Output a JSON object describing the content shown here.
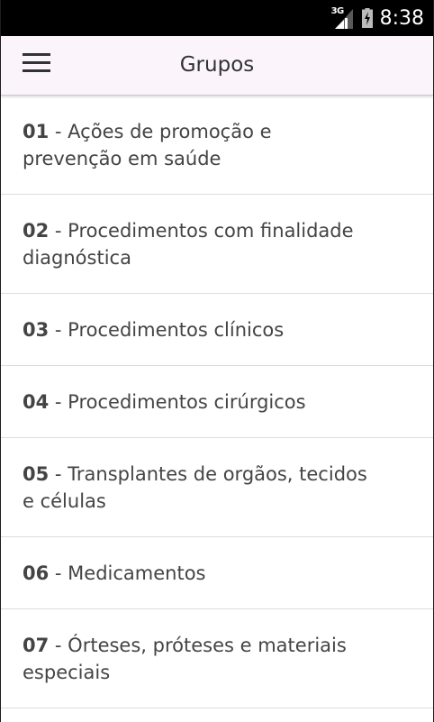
{
  "status_bar": {
    "network": "3G",
    "time": "8:38"
  },
  "app_bar": {
    "title": "Grupos",
    "menu_icon": "hamburger-menu-icon"
  },
  "groups": [
    {
      "code": "01",
      "separator": " - ",
      "name": "Ações de promoção e prevenção em saúde"
    },
    {
      "code": "02",
      "separator": " - ",
      "name": "Procedimentos com finalidade diagnóstica"
    },
    {
      "code": "03",
      "separator": " - ",
      "name": "Procedimentos clínicos"
    },
    {
      "code": "04",
      "separator": " - ",
      "name": "Procedimentos cirúrgicos"
    },
    {
      "code": "05",
      "separator": " - ",
      "name": "Transplantes de orgãos, tecidos e células"
    },
    {
      "code": "06",
      "separator": " - ",
      "name": "Medicamentos"
    },
    {
      "code": "07",
      "separator": " - ",
      "name": "Órteses, próteses e materiais especiais"
    }
  ]
}
